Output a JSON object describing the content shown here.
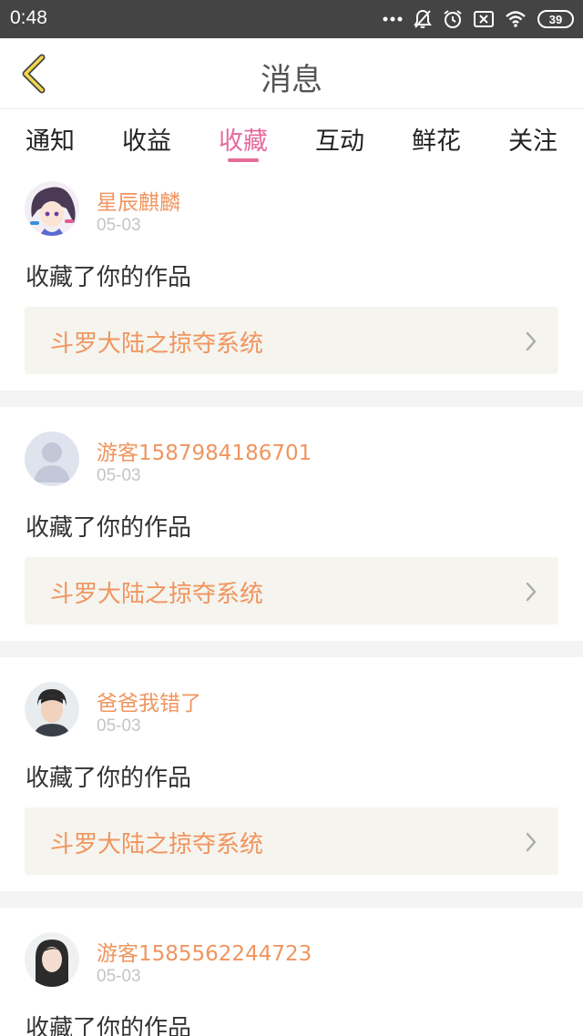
{
  "status_bar": {
    "time": "0:48",
    "battery": "39",
    "icons": [
      "more-dots-icon",
      "bell-off-icon",
      "alarm-icon",
      "sim-off-icon",
      "wifi-icon",
      "battery-icon"
    ]
  },
  "header": {
    "title": "消息",
    "back_icon": "chevron-left-icon"
  },
  "tabs": [
    {
      "label": "通知",
      "active": false
    },
    {
      "label": "收益",
      "active": false
    },
    {
      "label": "收藏",
      "active": true
    },
    {
      "label": "互动",
      "active": false
    },
    {
      "label": "鲜花",
      "active": false
    },
    {
      "label": "关注",
      "active": false
    }
  ],
  "colors": {
    "accent": "#e56b9a",
    "username": "#f0955f",
    "status_bar": "#444444",
    "work_box": "#f5f4ee"
  },
  "messages": [
    {
      "username": "星辰麒麟",
      "date": "05-03",
      "action": "收藏了你的作品",
      "work_title": "斗罗大陆之掠夺系统",
      "avatar": "anime-avatar"
    },
    {
      "username": "游客1587984186701",
      "date": "05-03",
      "action": "收藏了你的作品",
      "work_title": "斗罗大陆之掠夺系统",
      "avatar": "default-avatar"
    },
    {
      "username": "爸爸我错了",
      "date": "05-03",
      "action": "收藏了你的作品",
      "work_title": "斗罗大陆之掠夺系统",
      "avatar": "male-photo-avatar"
    },
    {
      "username": "游客1585562244723",
      "date": "05-03",
      "action": "收藏了你的作品",
      "work_title": "",
      "avatar": "female-photo-avatar"
    }
  ]
}
